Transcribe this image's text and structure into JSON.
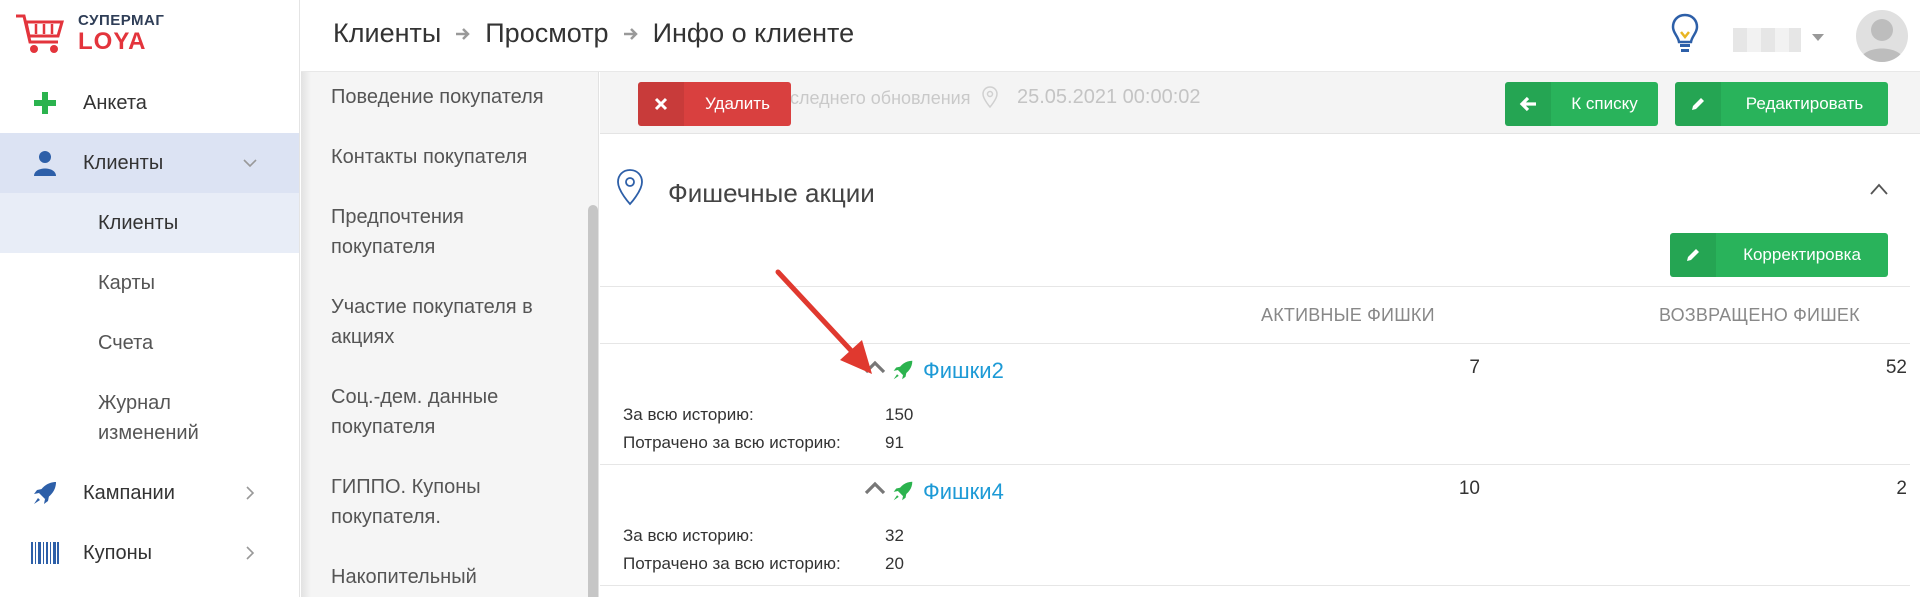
{
  "logo": {
    "line1": "СУПЕРМАГ",
    "line2": "LOYA",
    "brand_color": "#e3343c"
  },
  "sidebar": {
    "items": [
      {
        "label": "Анкета",
        "icon": "plus-icon",
        "active": false
      },
      {
        "label": "Клиенты",
        "icon": "user-icon",
        "active": true,
        "expanded": true
      },
      {
        "label": "Кампании",
        "icon": "rocket-icon",
        "active": false
      },
      {
        "label": "Купоны",
        "icon": "barcode-icon",
        "active": false
      }
    ],
    "clients_sub": [
      {
        "label": "Клиенты",
        "active": true
      },
      {
        "label": "Карты",
        "active": false
      },
      {
        "label": "Счета",
        "active": false
      },
      {
        "label": "Журнал изменений",
        "active": false
      }
    ]
  },
  "breadcrumb": [
    "Клиенты",
    "Просмотр",
    "Инфо о клиенте"
  ],
  "submenu": [
    "Поведение покупателя",
    "Контакты покупателя",
    "Предпочтения покупателя",
    "Участие покупателя в акциях",
    "Соц.-дем. данные покупателя",
    "ГИППО. Купоны покупателя.",
    "Накопительный"
  ],
  "actionbar": {
    "delete_label": "Удалить",
    "ghost_text": "оследнего обновления",
    "last_update": "25.05.2021 00:00:02",
    "back_label": "К списку",
    "edit_label": "Редактировать"
  },
  "section": {
    "title": "Фишечные акции",
    "correct_label": "Корректировка"
  },
  "table": {
    "columns": [
      "АКТИВНЫЕ ФИШКИ",
      "ВОЗВРАЩЕНО ФИШЕК"
    ],
    "rows": [
      {
        "name": "Фишки2",
        "active": "7",
        "returned": "52",
        "history_label": "За всю историю:",
        "history": "150",
        "spent_label": "Потрачено за всю историю:",
        "spent": "91"
      },
      {
        "name": "Фишки4",
        "active": "10",
        "returned": "2",
        "history_label": "За всю историю:",
        "history": "32",
        "spent_label": "Потрачено за всю историю:",
        "spent": "20"
      }
    ]
  },
  "colors": {
    "green": "#29b35b",
    "red": "#d9403f",
    "link": "#1d9ad6",
    "active_nav": "#dce3f3",
    "annotation_arrow": "#e0392f"
  }
}
